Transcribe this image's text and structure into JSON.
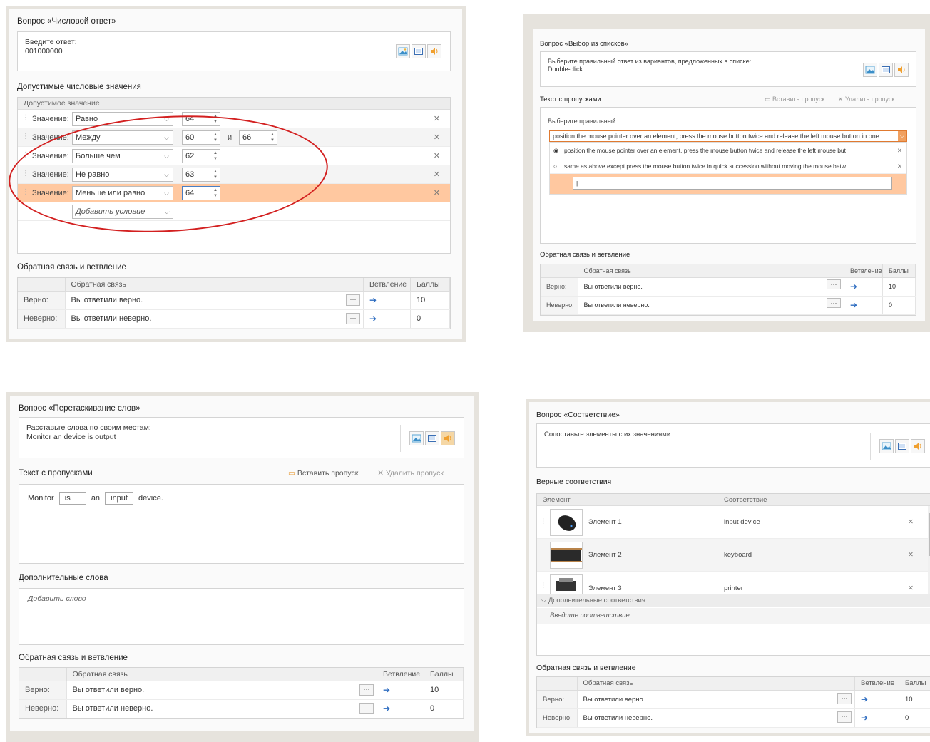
{
  "panel1": {
    "title": "Вопрос «Числовой ответ»",
    "prompt": "Введите ответ:",
    "answer": "001000000",
    "values_section": "Допустимые числовые значения",
    "values_header": "Допустимое значение",
    "value_label": "Значение:",
    "rows": [
      {
        "cond": "Равно",
        "v1": "64",
        "v2": ""
      },
      {
        "cond": "Между",
        "v1": "60",
        "v2": "66",
        "and": "и"
      },
      {
        "cond": "Больше чем",
        "v1": "62",
        "v2": ""
      },
      {
        "cond": "Не равно",
        "v1": "63",
        "v2": ""
      },
      {
        "cond": "Меньше или равно",
        "v1": "64",
        "v2": ""
      }
    ],
    "add_condition": "Добавить условие",
    "feedback_section": "Обратная связь и ветвление",
    "fb_col": "Обратная связь",
    "branch_col": "Ветвление",
    "score_col": "Баллы",
    "correct_label": "Верно:",
    "correct_text": "Вы ответили верно.",
    "correct_score": "10",
    "wrong_label": "Неверно:",
    "wrong_text": "Вы ответили неверно.",
    "wrong_score": "0"
  },
  "panel2": {
    "title": "Вопрос «Выбор из списков»",
    "prompt": "Выберите правильный ответ из вариантов, предложенных в списке:",
    "answer": "Double-click",
    "text_section": "Текст с пропусками",
    "insert_gap": "Вставить пропуск",
    "delete_gap": "Удалить пропуск",
    "sentence": "Выберите правильный",
    "dropdown_value": "position the mouse pointer over an element, press the mouse button twice and release the left mouse button in one",
    "option1": "position the mouse pointer over an element, press the mouse button twice and release the left mouse but",
    "option2": "same as above except press the mouse button twice in quick succession without moving the mouse betw",
    "feedback_section": "Обратная связь и ветвление",
    "fb_col": "Обратная связь",
    "branch_col": "Ветвление",
    "score_col": "Баллы",
    "correct_label": "Верно:",
    "correct_text": "Вы ответили верно.",
    "correct_score": "10",
    "wrong_label": "Неверно:",
    "wrong_text": "Вы ответили неверно.",
    "wrong_score": "0"
  },
  "panel3": {
    "title": "Вопрос «Перетаскивание слов»",
    "prompt": "Расставьте слова по своим местам:",
    "answer": "Monitor an device is output",
    "text_section": "Текст с пропусками",
    "insert_gap": "Вставить пропуск",
    "delete_gap": "Удалить пропуск",
    "w1": "Monitor",
    "gap1": "is",
    "w2": "an",
    "gap2": "input",
    "w3": "device.",
    "extra_section": "Дополнительные слова",
    "add_word": "Добавить слово",
    "feedback_section": "Обратная связь и ветвление",
    "fb_col": "Обратная связь",
    "branch_col": "Ветвление",
    "score_col": "Баллы",
    "correct_label": "Верно:",
    "correct_text": "Вы ответили верно.",
    "correct_score": "10",
    "wrong_label": "Неверно:",
    "wrong_text": "Вы ответили неверно.",
    "wrong_score": "0"
  },
  "panel4": {
    "title": "Вопрос «Соответствие»",
    "prompt": "Сопоставьте элементы с их значениями:",
    "matches_section": "Верные соответствия",
    "col_element": "Элемент",
    "col_match": "Соответствие",
    "items": [
      {
        "name": "Элемент 1",
        "match": "input device"
      },
      {
        "name": "Элемент 2",
        "match": "keyboard"
      },
      {
        "name": "Элемент 3",
        "match": "printer"
      }
    ],
    "extra_section": "Дополнительные соответствия",
    "extra_placeholder": "Введите соответствие",
    "feedback_section": "Обратная связь и ветвление",
    "fb_col": "Обратная связь",
    "branch_col": "Ветвление",
    "score_col": "Баллы",
    "correct_label": "Верно:",
    "correct_text": "Вы ответили верно.",
    "correct_score": "10",
    "wrong_label": "Неверно:",
    "wrong_text": "Вы ответили неверно.",
    "wrong_score": "0"
  }
}
